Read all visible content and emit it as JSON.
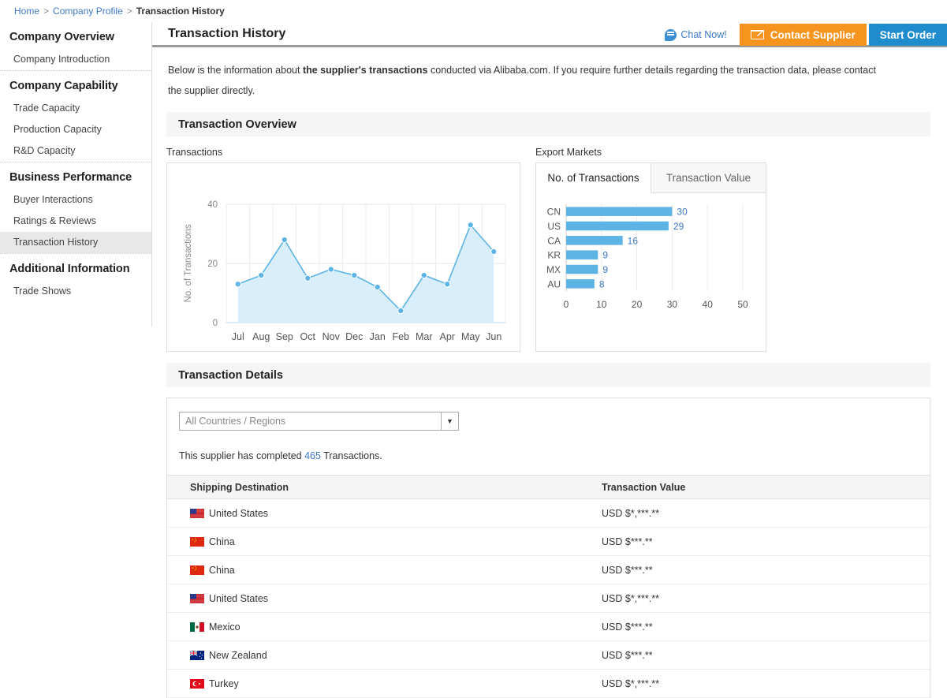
{
  "breadcrumb": {
    "home": "Home",
    "sep": ">",
    "company_profile": "Company Profile",
    "current": "Transaction History"
  },
  "sidebar": {
    "groups": [
      {
        "head": "Company Overview",
        "items": [
          {
            "label": "Company Introduction",
            "active": false
          }
        ]
      },
      {
        "head": "Company Capability",
        "items": [
          {
            "label": "Trade Capacity",
            "active": false
          },
          {
            "label": "Production Capacity",
            "active": false
          },
          {
            "label": "R&D Capacity",
            "active": false
          }
        ]
      },
      {
        "head": "Business Performance",
        "items": [
          {
            "label": "Buyer Interactions",
            "active": false
          },
          {
            "label": "Ratings & Reviews",
            "active": false
          },
          {
            "label": "Transaction History",
            "active": true
          }
        ]
      },
      {
        "head": "Additional Information",
        "items": [
          {
            "label": "Trade Shows",
            "active": false
          }
        ]
      }
    ]
  },
  "header": {
    "title": "Transaction History",
    "chat_now": "Chat Now!",
    "contact_supplier": "Contact Supplier",
    "start_order": "Start Order"
  },
  "intro": {
    "part1": "Below is the information about ",
    "bold": "the supplier's transactions",
    "part2": " conducted via Alibaba.com. If you require further details regarding the transaction data, please contact the supplier directly."
  },
  "sections": {
    "overview": "Transaction Overview",
    "details": "Transaction Details"
  },
  "line_caption": "Transactions",
  "markets_caption": "Export Markets",
  "markets_tabs": [
    {
      "label": "No. of Transactions",
      "active": true
    },
    {
      "label": "Transaction Value",
      "active": false
    }
  ],
  "details": {
    "filter_value": "All Countries / Regions",
    "completed_prefix": "This supplier has completed ",
    "completed_count": "465",
    "completed_suffix": " Transactions.",
    "columns": [
      "Shipping Destination",
      "Transaction Value"
    ],
    "rows": [
      {
        "country": "United States",
        "flag": "us",
        "value": "USD $*,***.**"
      },
      {
        "country": "China",
        "flag": "cn",
        "value": "USD $***.**"
      },
      {
        "country": "China",
        "flag": "cn",
        "value": "USD $***.**"
      },
      {
        "country": "United States",
        "flag": "us",
        "value": "USD $*,***.**"
      },
      {
        "country": "Mexico",
        "flag": "mx",
        "value": "USD $***.**"
      },
      {
        "country": "New Zealand",
        "flag": "nz",
        "value": "USD $***.**"
      },
      {
        "country": "Turkey",
        "flag": "tr",
        "value": "USD $*,***.**"
      }
    ]
  },
  "colors": {
    "accent_orange": "#f7941e",
    "accent_blue": "#1f8ccd",
    "link_blue": "#3c78c8",
    "chart_line": "#5cb3e4",
    "chart_fill": "#d8eefa",
    "bar_fill": "#5cb3e4"
  },
  "chart_data": [
    {
      "type": "area",
      "title": "Transactions",
      "xlabel": "",
      "ylabel": "No. of Transactions",
      "categories": [
        "Jul",
        "Aug",
        "Sep",
        "Oct",
        "Nov",
        "Dec",
        "Jan",
        "Feb",
        "Mar",
        "Apr",
        "May",
        "Jun"
      ],
      "values": [
        13,
        16,
        28,
        15,
        18,
        16,
        12,
        4,
        16,
        13,
        33,
        24
      ],
      "ylim": [
        0,
        40
      ],
      "yticks": [
        0,
        20,
        40
      ],
      "grid": true,
      "legend": "none"
    },
    {
      "type": "bar",
      "title": "Export Markets",
      "orientation": "horizontal",
      "xlabel": "",
      "ylabel": "",
      "categories": [
        "CN",
        "US",
        "CA",
        "KR",
        "MX",
        "AU"
      ],
      "values": [
        30,
        29,
        16,
        9,
        9,
        8
      ],
      "labels": [
        "30",
        "29",
        "16",
        "9",
        "9",
        "8"
      ],
      "xlim": [
        0,
        50
      ],
      "xticks": [
        0,
        10,
        20,
        30,
        40,
        50
      ],
      "grid": true,
      "legend": "none"
    }
  ]
}
